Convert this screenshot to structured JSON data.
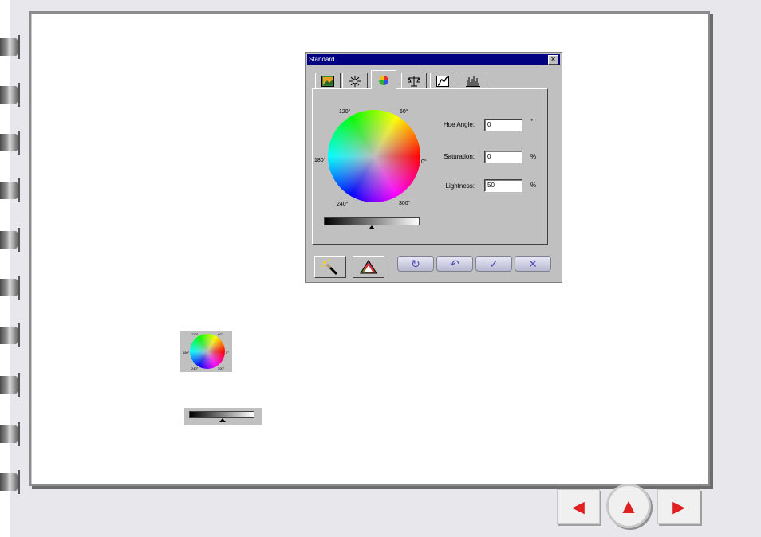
{
  "dialog": {
    "title": "Standard",
    "close_glyph": "✕",
    "tabs": [
      {
        "icon": "image-icon"
      },
      {
        "icon": "brightness-icon"
      },
      {
        "icon": "color-wheel-icon",
        "active": true
      },
      {
        "icon": "balance-icon"
      },
      {
        "icon": "curve-icon"
      },
      {
        "icon": "histogram-icon"
      }
    ],
    "wheel_labels": {
      "deg120": "120°",
      "deg60": "60°",
      "deg180": "180°",
      "deg0": "0°",
      "deg240": "240°",
      "deg300": "300°"
    },
    "fields": {
      "hue": {
        "label": "Hue Angle:",
        "value": "0",
        "unit": "°"
      },
      "saturation": {
        "label": "Saturation:",
        "value": "0",
        "unit": "%"
      },
      "lightness": {
        "label": "Lightness:",
        "value": "50",
        "unit": "%"
      }
    },
    "lightness_slider_level": 0.5,
    "buttons": {
      "reset": "↻",
      "undo": "↶",
      "ok": "✓",
      "cancel": "✕"
    }
  },
  "mini": {
    "wheel_labels": {
      "deg120": "120°",
      "deg60": "60°",
      "deg180": "180°",
      "deg0": "0°",
      "deg240": "240°",
      "deg300": "300°"
    }
  },
  "nav": {
    "prev_glyph": "◄",
    "up_glyph": "▲",
    "next_glyph": "►"
  },
  "colors": {
    "accent_red": "#e02020",
    "titlebar": "#000080"
  }
}
